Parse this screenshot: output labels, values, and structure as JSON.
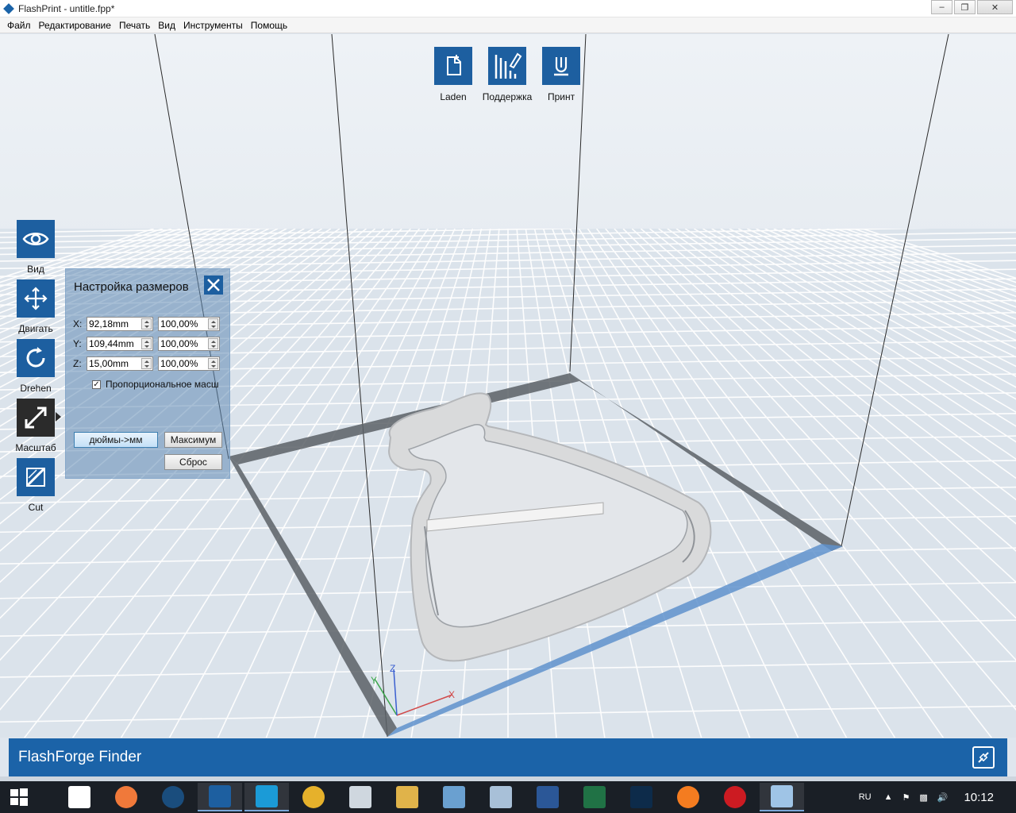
{
  "window": {
    "title": "FlashPrint - untitle.fpp*",
    "controls": [
      "minimize-icon",
      "restore-icon",
      "close-icon"
    ]
  },
  "menu": [
    "Файл",
    "Редактирование",
    "Печать",
    "Вид",
    "Инструменты",
    "Помощь"
  ],
  "top_toolbar": [
    {
      "label": "Laden",
      "icon": "load-file-icon"
    },
    {
      "label": "Поддержка",
      "icon": "support-icon"
    },
    {
      "label": "Принт",
      "icon": "print-icon"
    }
  ],
  "left_toolbar": [
    {
      "label": "Вид",
      "icon": "eye-icon"
    },
    {
      "label": "Двигать",
      "icon": "move-icon"
    },
    {
      "label": "Drehen",
      "icon": "rotate-icon"
    },
    {
      "label": "Масштаб",
      "icon": "scale-icon",
      "active": true
    },
    {
      "label": "Cut",
      "icon": "cut-icon"
    }
  ],
  "scale_panel": {
    "title": "Настройка размеров",
    "rows": [
      {
        "axis": "X:",
        "size": "92,18mm",
        "percent": "100,00%"
      },
      {
        "axis": "Y:",
        "size": "109,44mm",
        "percent": "100,00%"
      },
      {
        "axis": "Z:",
        "size": "15,00mm",
        "percent": "100,00%"
      }
    ],
    "proportional_label": "Пропорциональное масш",
    "proportional_checked": true,
    "btn_inch_mm": "дюймы->мм",
    "btn_max": "Максимум",
    "btn_reset": "Сброс"
  },
  "axes": {
    "x": "X",
    "y": "Y",
    "z": "Z"
  },
  "status": {
    "brand": "FlashForge Finder",
    "icon": "connect-icon"
  },
  "taskbar": {
    "apps": [
      "start-icon",
      "printer-app-icon",
      "origin-icon",
      "steam-icon",
      "flashprint-icon",
      "c-app-icon",
      "chrome-icon",
      "calculator-icon",
      "file-explorer-icon",
      "paint-icon",
      "network-app-icon",
      "word-icon",
      "excel-icon",
      "photoshop-icon",
      "firefox-icon",
      "opera-icon",
      "notes-icon"
    ],
    "lang": "RU",
    "time": "10:12"
  },
  "colors": {
    "accent": "#1b63a8",
    "button_blue": "#1d5fa0",
    "active_tool": "#2b2b2b",
    "taskbar": "#1a1f26"
  }
}
